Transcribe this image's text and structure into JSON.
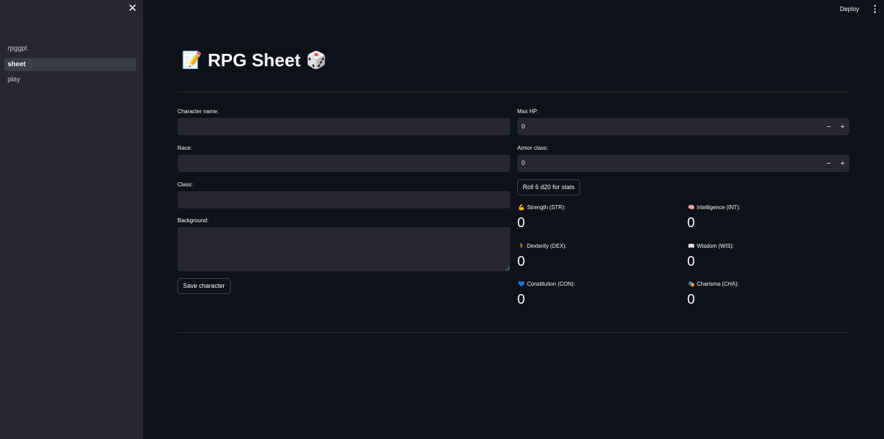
{
  "sidebar": {
    "close_glyph": "✕",
    "items": [
      {
        "label": "rpggpt"
      },
      {
        "label": "sheet",
        "active": true
      },
      {
        "label": "play"
      }
    ]
  },
  "topbar": {
    "deploy_label": "Deploy",
    "menu_icon": "kebab-menu-icon"
  },
  "page": {
    "title": "RPG Sheet",
    "title_icon_left": "📝",
    "title_icon_right": "🎲"
  },
  "form": {
    "character_name": {
      "label": "Character name:",
      "value": ""
    },
    "race": {
      "label": "Race:",
      "value": ""
    },
    "class": {
      "label": "Class:",
      "value": ""
    },
    "background": {
      "label": "Background:",
      "value": ""
    },
    "save_label": "Save character"
  },
  "right": {
    "max_hp": {
      "label": "Max HP:",
      "value": "0"
    },
    "armor_class": {
      "label": "Armor class:",
      "value": "0"
    },
    "stepper_minus": "−",
    "stepper_plus": "+",
    "roll_label": "Roll 6 d20 for stats"
  },
  "stats": [
    {
      "icon": "💪",
      "label": "Strength (STR):",
      "value": "0"
    },
    {
      "icon": "🧠",
      "label": "Intelligence (INT):",
      "value": "0"
    },
    {
      "icon": "🏃",
      "label": "Dexterity (DEX):",
      "value": "0"
    },
    {
      "icon": "📖",
      "label": "Wisdom (WIS):",
      "value": "0"
    },
    {
      "icon": "💙",
      "label": "Constitution (CON):",
      "value": "0"
    },
    {
      "icon": "🎭",
      "label": "Charisma (CHA):",
      "value": "0"
    }
  ],
  "colors": {
    "background": "#0e1117",
    "sidebar": "#262730",
    "input": "#262730",
    "text": "#fafafa"
  }
}
